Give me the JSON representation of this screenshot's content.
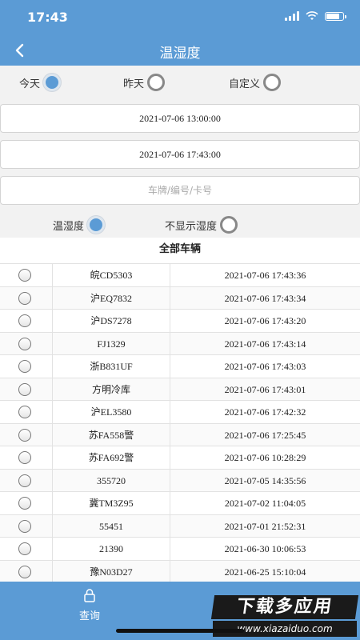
{
  "status": {
    "time": "17:43"
  },
  "header": {
    "title": "温湿度"
  },
  "date_range": {
    "options": [
      {
        "label": "今天",
        "checked": true
      },
      {
        "label": "昨天",
        "checked": false
      },
      {
        "label": "自定义",
        "checked": false
      }
    ],
    "start": "2021-07-06 13:00:00",
    "end": "2021-07-06 17:43:00"
  },
  "search": {
    "placeholder": "车牌/编号/卡号"
  },
  "display": {
    "options": [
      {
        "label": "温湿度",
        "checked": true
      },
      {
        "label": "不显示湿度",
        "checked": false
      }
    ]
  },
  "vehicles": {
    "title": "全部车辆",
    "rows": [
      {
        "plate": "皖CD5303",
        "time": "2021-07-06 17:43:36"
      },
      {
        "plate": "沪EQ7832",
        "time": "2021-07-06 17:43:34"
      },
      {
        "plate": "沪DS7278",
        "time": "2021-07-06 17:43:20"
      },
      {
        "plate": "FJ1329",
        "time": "2021-07-06 17:43:14"
      },
      {
        "plate": "浙B831UF",
        "time": "2021-07-06 17:43:03"
      },
      {
        "plate": "方明冷库",
        "time": "2021-07-06 17:43:01"
      },
      {
        "plate": "沪EL3580",
        "time": "2021-07-06 17:42:32"
      },
      {
        "plate": "苏FA558警",
        "time": "2021-07-06 17:25:45"
      },
      {
        "plate": "苏FA692警",
        "time": "2021-07-06 10:28:29"
      },
      {
        "plate": "355720",
        "time": "2021-07-05 14:35:56"
      },
      {
        "plate": "冀TM3Z95",
        "time": "2021-07-02 11:04:05"
      },
      {
        "plate": "55451",
        "time": "2021-07-01 21:52:31"
      },
      {
        "plate": "21390",
        "time": "2021-06-30 10:06:53"
      },
      {
        "plate": "豫N03D27",
        "time": "2021-06-25 15:10:04"
      }
    ]
  },
  "bottom": {
    "query_label": "查询"
  },
  "watermark": {
    "title": "下载多应用",
    "url": "www.xiazaiduo.com"
  },
  "colors": {
    "accent": "#5b9bd5",
    "background": "#f2f2f2"
  }
}
